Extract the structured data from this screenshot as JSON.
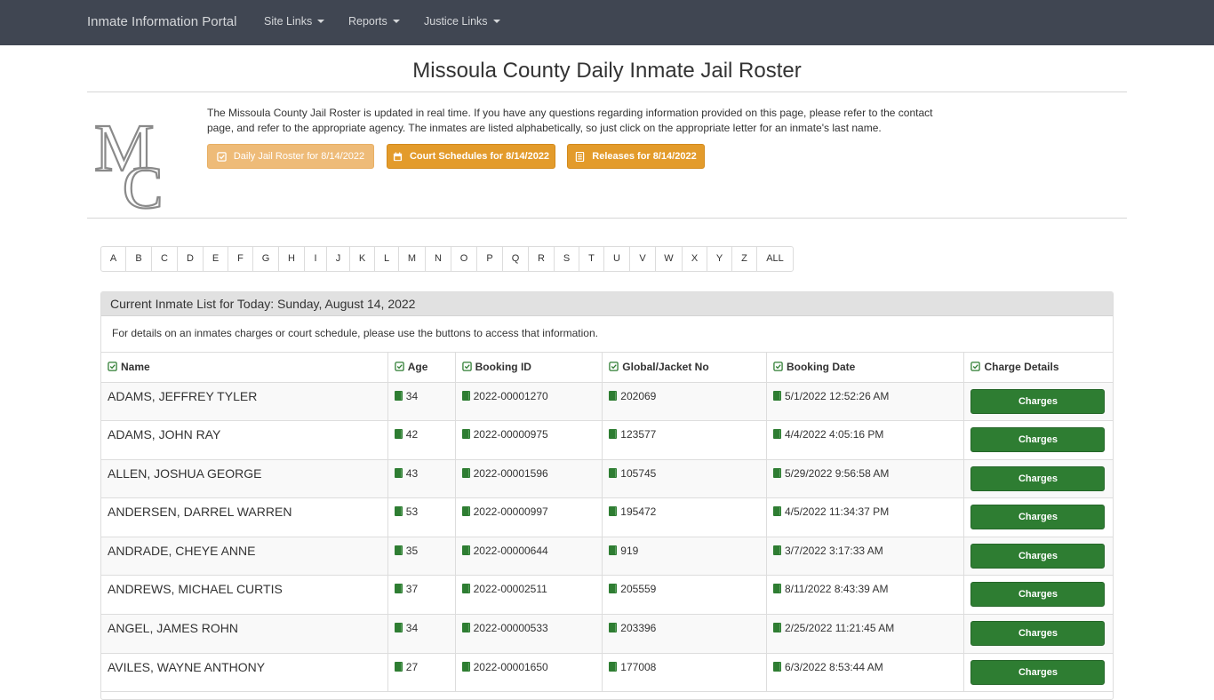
{
  "navbar": {
    "brand": "Inmate Information Portal",
    "items": [
      "Site Links",
      "Reports",
      "Justice Links"
    ]
  },
  "header": {
    "title": "Missoula County Daily Inmate Jail Roster",
    "intro_line1": "The Missoula County Jail Roster is updated in real time. If you have any questions regarding information provided on this page, please refer to the contact",
    "intro_line2": "page, and refer to the appropriate agency. The inmates are listed alphabetically, so just click on the appropriate letter for an inmate's last name.",
    "buttons": {
      "roster": "Daily Jail Roster for 8/14/2022",
      "court": "Court Schedules for 8/14/2022",
      "releases": "Releases for 8/14/2022"
    }
  },
  "alphabet": [
    "A",
    "B",
    "C",
    "D",
    "E",
    "F",
    "G",
    "H",
    "I",
    "J",
    "K",
    "L",
    "M",
    "N",
    "O",
    "P",
    "Q",
    "R",
    "S",
    "T",
    "U",
    "V",
    "W",
    "X",
    "Y",
    "Z",
    "ALL"
  ],
  "panel": {
    "heading": "Current Inmate List for Today: Sunday, August 14, 2022",
    "note": "For details on an inmates charges or court schedule, please use the buttons to access that information.",
    "columns": [
      "Name",
      "Age",
      "Booking ID",
      "Global/Jacket No",
      "Booking Date",
      "Charge Details"
    ],
    "button_label": "Charges",
    "rows": [
      {
        "name": "ADAMS, JEFFREY TYLER",
        "age": "34",
        "booking_id": "2022-00001270",
        "jacket": "202069",
        "date": "5/1/2022 12:52:26 AM"
      },
      {
        "name": "ADAMS, JOHN RAY",
        "age": "42",
        "booking_id": "2022-00000975",
        "jacket": "123577",
        "date": "4/4/2022 4:05:16 PM"
      },
      {
        "name": "ALLEN, JOSHUA GEORGE",
        "age": "43",
        "booking_id": "2022-00001596",
        "jacket": "105745",
        "date": "5/29/2022 9:56:58 AM"
      },
      {
        "name": "ANDERSEN, DARREL WARREN",
        "age": "53",
        "booking_id": "2022-00000997",
        "jacket": "195472",
        "date": "4/5/2022 11:34:37 PM"
      },
      {
        "name": "ANDRADE, CHEYE ANNE",
        "age": "35",
        "booking_id": "2022-00000644",
        "jacket": "919",
        "date": "3/7/2022 3:17:33 AM"
      },
      {
        "name": "ANDREWS, MICHAEL CURTIS",
        "age": "37",
        "booking_id": "2022-00002511",
        "jacket": "205559",
        "date": "8/11/2022 8:43:39 AM"
      },
      {
        "name": "ANGEL, JAMES ROHN",
        "age": "34",
        "booking_id": "2022-00000533",
        "jacket": "203396",
        "date": "2/25/2022 11:21:45 AM"
      },
      {
        "name": "AVILES, WAYNE ANTHONY",
        "age": "27",
        "booking_id": "2022-00001650",
        "jacket": "177008",
        "date": "6/3/2022 8:53:44 AM"
      }
    ]
  }
}
